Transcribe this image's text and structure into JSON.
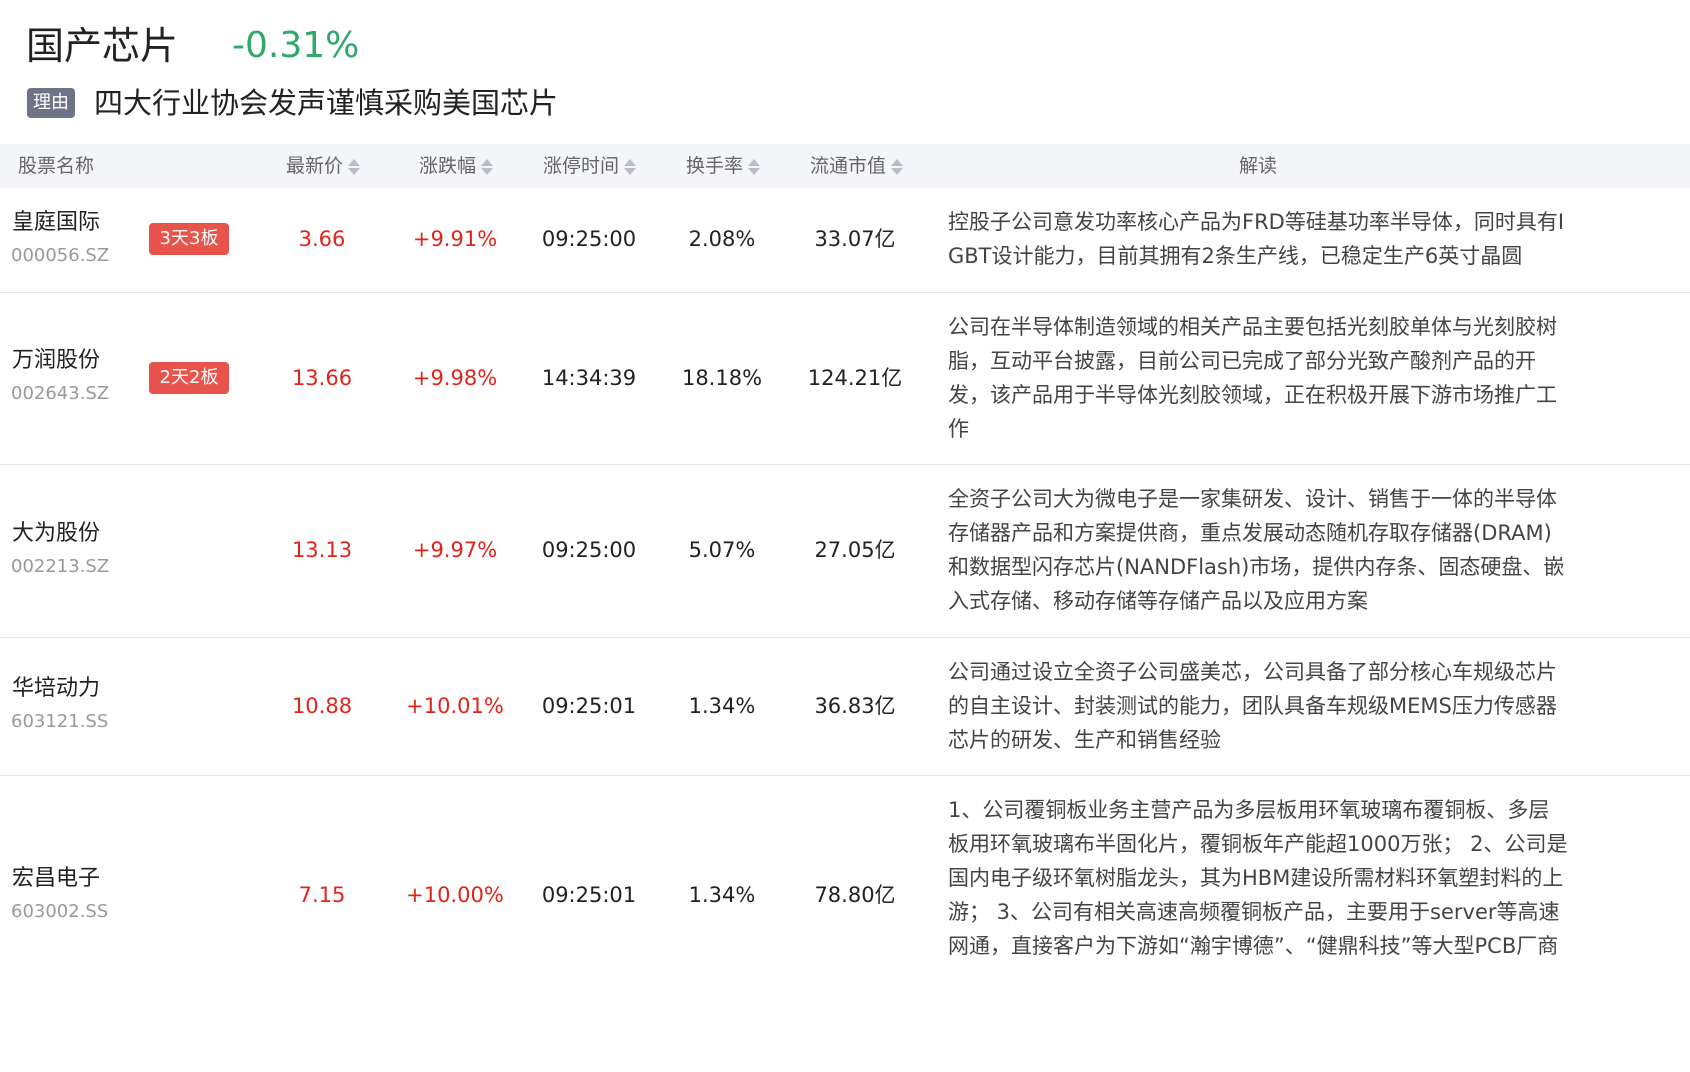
{
  "header": {
    "sector_name": "国产芯片",
    "sector_change": "-0.31%",
    "reason_label": "理由",
    "reason_text": "四大行业协会发声谨慎采购美国芯片"
  },
  "columns": {
    "name": "股票名称",
    "price": "最新价",
    "change": "涨跌幅",
    "limit_time": "涨停时间",
    "turnover": "换手率",
    "market_cap": "流通市值",
    "interpretation": "解读"
  },
  "colors": {
    "up": "#e2231a",
    "down": "#2fa86a",
    "badge_red": "#e8534c",
    "badge_gray": "#6e7385",
    "header_bg": "#f4f5f8"
  },
  "rows": [
    {
      "name": "皇庭国际",
      "code": "000056.SZ",
      "badge": "3天3板",
      "price": "3.66",
      "change": "+9.91%",
      "limit_time": "09:25:00",
      "turnover": "2.08%",
      "market_cap": "33.07亿",
      "interpretation": "控股子公司意发功率核心产品为FRD等硅基功率半导体，同时具有IGBT设计能力，目前其拥有2条生产线，已稳定生产6英寸晶圆"
    },
    {
      "name": "万润股份",
      "code": "002643.SZ",
      "badge": "2天2板",
      "price": "13.66",
      "change": "+9.98%",
      "limit_time": "14:34:39",
      "turnover": "18.18%",
      "market_cap": "124.21亿",
      "interpretation": "公司在半导体制造领域的相关产品主要包括光刻胶单体与光刻胶树脂，互动平台披露，目前公司已完成了部分光致产酸剂产品的开发，该产品用于半导体光刻胶领域，正在积极开展下游市场推广工作"
    },
    {
      "name": "大为股份",
      "code": "002213.SZ",
      "badge": "",
      "price": "13.13",
      "change": "+9.97%",
      "limit_time": "09:25:00",
      "turnover": "5.07%",
      "market_cap": "27.05亿",
      "interpretation": "全资子公司大为微电子是一家集研发、设计、销售于一体的半导体存储器产品和方案提供商，重点发展动态随机存取存储器(DRAM)和数据型闪存芯片(NANDFlash)市场，提供内存条、固态硬盘、嵌入式存储、移动存储等存储产品以及应用方案"
    },
    {
      "name": "华培动力",
      "code": "603121.SS",
      "badge": "",
      "price": "10.88",
      "change": "+10.01%",
      "limit_time": "09:25:01",
      "turnover": "1.34%",
      "market_cap": "36.83亿",
      "interpretation": "公司通过设立全资子公司盛美芯，公司具备了部分核心车规级芯片的自主设计、封装测试的能力，团队具备车规级MEMS压力传感器芯片的研发、生产和销售经验"
    },
    {
      "name": "宏昌电子",
      "code": "603002.SS",
      "badge": "",
      "price": "7.15",
      "change": "+10.00%",
      "limit_time": "09:25:01",
      "turnover": "1.34%",
      "market_cap": "78.80亿",
      "interpretation": "1、公司覆铜板业务主营产品为多层板用环氧玻璃布覆铜板、多层板用环氧玻璃布半固化片，覆铜板年产能超1000万张； 2、公司是国内电子级环氧树脂龙头，其为HBM建设所需材料环氧塑封料的上游； 3、公司有相关高速高频覆铜板产品，主要用于server等高速网通，直接客户为下游如“瀚宇博德”、“健鼎科技”等大型PCB厂商"
    }
  ]
}
